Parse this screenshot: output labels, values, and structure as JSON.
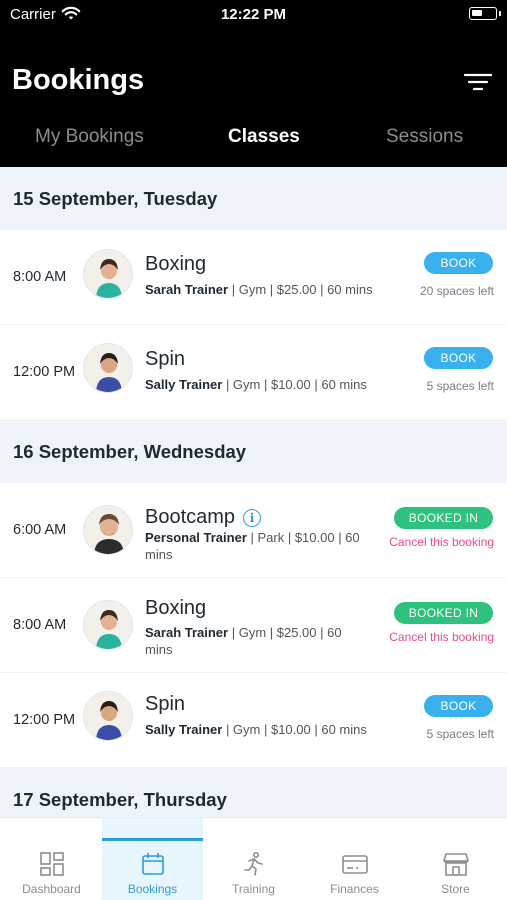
{
  "status_bar": {
    "carrier": "Carrier",
    "time": "12:22 PM"
  },
  "header": {
    "title": "Bookings"
  },
  "tabs": [
    {
      "label": "My Bookings"
    },
    {
      "label": "Classes"
    },
    {
      "label": "Sessions"
    }
  ],
  "days": [
    {
      "date": "15 September, Tuesday",
      "classes": [
        {
          "time": "8:00 AM",
          "name": "Boxing",
          "trainer": "Sarah Trainer",
          "details": " | Gym | $25.00 | 60 mins",
          "status": "BOOK",
          "sub": "20 spaces left"
        },
        {
          "time": "12:00 PM",
          "name": "Spin",
          "trainer": "Sally Trainer",
          "details": " | Gym | $10.00 | 60 mins",
          "status": "BOOK",
          "sub": "5 spaces left"
        }
      ]
    },
    {
      "date": "16 September, Wednesday",
      "classes": [
        {
          "time": "6:00 AM",
          "name": "Bootcamp",
          "trainer": "Personal Trainer",
          "details": " | Park | $10.00 | 60 mins",
          "status": "BOOKED IN",
          "sub": "Cancel this booking"
        },
        {
          "time": "8:00 AM",
          "name": "Boxing",
          "trainer": "Sarah Trainer",
          "details": " | Gym | $25.00 | 60 mins",
          "status": "BOOKED IN",
          "sub": "Cancel this booking"
        },
        {
          "time": "12:00 PM",
          "name": "Spin",
          "trainer": "Sally Trainer",
          "details": " | Gym | $10.00 | 60 mins",
          "status": "BOOK",
          "sub": "5 spaces left"
        }
      ]
    },
    {
      "date": "17 September, Thursday"
    }
  ],
  "tab_bar": [
    {
      "label": "Dashboard",
      "icon": "dashboard-icon"
    },
    {
      "label": "Bookings",
      "icon": "calendar-icon"
    },
    {
      "label": "Training",
      "icon": "running-person-icon"
    },
    {
      "label": "Finances",
      "icon": "credit-card-icon"
    },
    {
      "label": "Store",
      "icon": "store-icon"
    }
  ],
  "colors": {
    "accent": "#2d9cdb",
    "book": "#3ab1ef",
    "booked": "#2ec27e",
    "cancel": "#ea4c89"
  }
}
